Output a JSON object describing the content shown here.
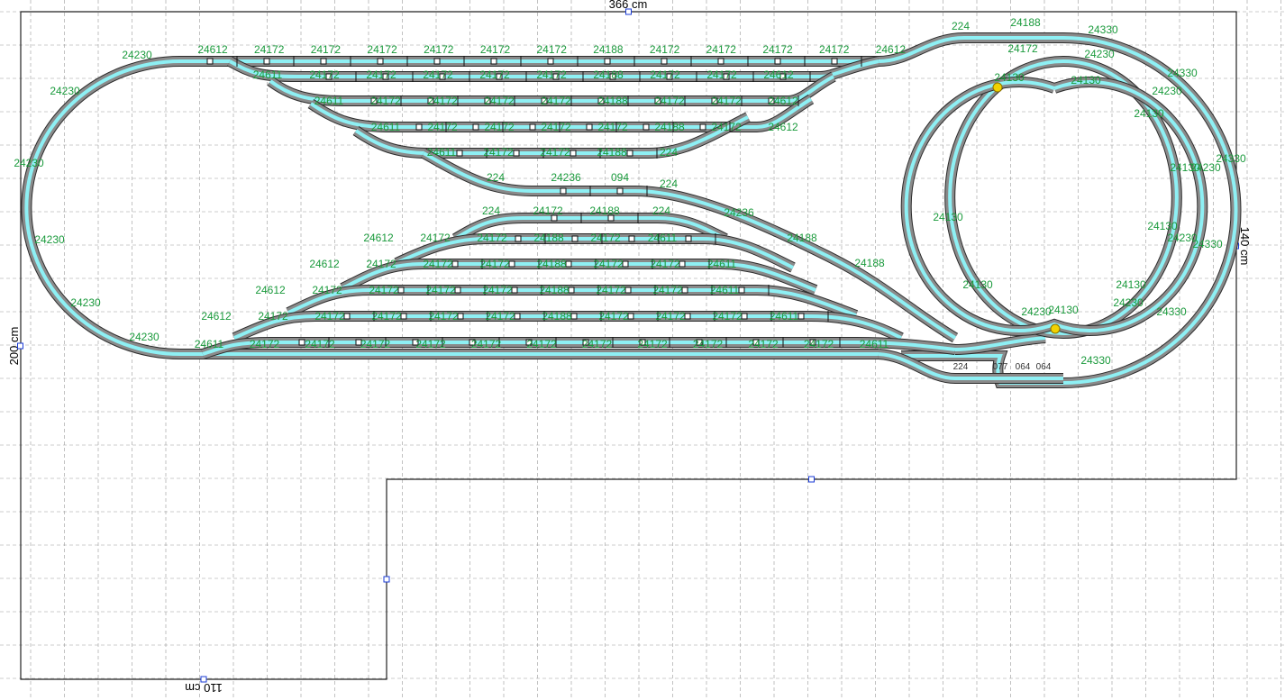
{
  "colors": {
    "background": "#ffffff",
    "grid": "#9a9a9a",
    "board_outline": "#222222",
    "handle": "#1a3bd6",
    "track_body": "#8a8a8a",
    "track_center": "#8ef0f4",
    "track_edge": "#2c2c2c",
    "label": "#1a9a3c",
    "marker": "#f1d200"
  },
  "dimensions": {
    "top": "366 cm",
    "left": "200 cm",
    "right": "140 cm",
    "bottom": "110 cm"
  },
  "pieces": {
    "top_row": [
      "24612",
      "24172",
      "24172",
      "24172",
      "24172",
      "24172",
      "24172",
      "24188",
      "24172",
      "24172",
      "24172",
      "24172",
      "24612"
    ],
    "yard_upper": [
      [
        "24611",
        "24172",
        "24172",
        "24172",
        "24172",
        "24172",
        "24188",
        "24172",
        "24172",
        "24612"
      ],
      [
        "24611",
        "24172",
        "24172",
        "24172",
        "24172",
        "24188",
        "24172",
        "24172",
        "24612"
      ],
      [
        "24611",
        "24172",
        "24172",
        "24172",
        "24172",
        "24188",
        "24172",
        "24612"
      ],
      [
        "24611",
        "24172",
        "24172",
        "24188",
        "224"
      ]
    ],
    "middle": [
      "224",
      "24236",
      "094",
      "224",
      "24236",
      "24188",
      "24188"
    ],
    "yard_lower": [
      [
        "224",
        "24172",
        "24188",
        "224"
      ],
      [
        "24612",
        "24172",
        "24172",
        "24188",
        "24172",
        "24611"
      ],
      [
        "24612",
        "24172",
        "24172",
        "24172",
        "24188",
        "24172",
        "24172",
        "24611"
      ],
      [
        "24612",
        "24172",
        "24172",
        "24172",
        "24172",
        "24188",
        "24172",
        "24172",
        "24611"
      ],
      [
        "24612",
        "24172",
        "24172",
        "24172",
        "24172",
        "24172",
        "24188",
        "24172",
        "24172",
        "24172",
        "24611"
      ]
    ],
    "bottom_row": [
      "24611",
      "24172",
      "24172",
      "24172",
      "24172",
      "24172",
      "24172",
      "24172",
      "24172",
      "24172",
      "24172",
      "24172",
      "24611"
    ],
    "left_loop": [
      "24230",
      "24230",
      "24230",
      "24230",
      "24230",
      "24230"
    ],
    "helix_outer": [
      "224",
      "24188",
      "24330",
      "24330",
      "24330",
      "24330",
      "24330",
      "24330"
    ],
    "helix_middle": [
      "24172",
      "24230",
      "24230",
      "24230",
      "24230",
      "24230",
      "24230"
    ],
    "helix_inner": [
      "24130",
      "24130",
      "24130",
      "24130",
      "24130",
      "24130",
      "24130",
      "24130",
      "24130"
    ],
    "bottom_connector": [
      "224",
      "077",
      "064",
      "064"
    ]
  }
}
